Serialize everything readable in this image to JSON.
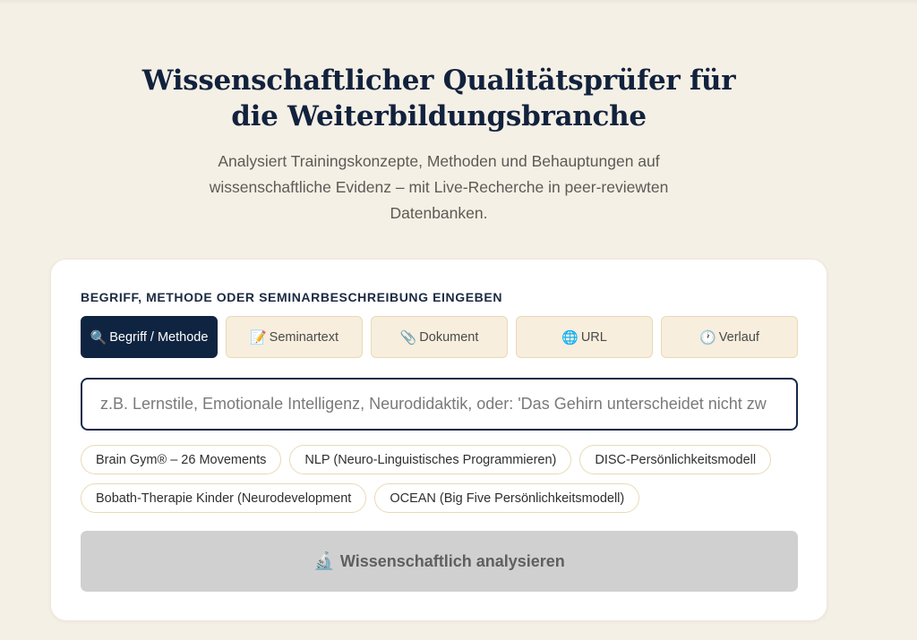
{
  "header": {
    "title": "Wissenschaftlicher Qualitätsprüfer für die Weiterbildungsbranche",
    "subtitle": "Analysiert Trainingskonzepte, Methoden und Behauptungen auf wissenschaftliche Evidenz – mit Live-Recherche in peer-reviewten Datenbanken."
  },
  "form": {
    "section_label": "BEGRIFF, METHODE ODER SEMINARBESCHREIBUNG EINGEBEN",
    "tabs": [
      {
        "icon": "🔍",
        "icon_name": "magnifier-icon",
        "label": "Begriff / Methode",
        "active": true
      },
      {
        "icon": "📝",
        "icon_name": "memo-icon",
        "label": "Seminartext",
        "active": false
      },
      {
        "icon": "📎",
        "icon_name": "paperclip-icon",
        "label": "Dokument",
        "active": false
      },
      {
        "icon": "🌐",
        "icon_name": "globe-icon",
        "label": "URL",
        "active": false
      },
      {
        "icon": "🕐",
        "icon_name": "clock-icon",
        "label": "Verlauf",
        "active": false
      }
    ],
    "input": {
      "value": "",
      "placeholder": "z.B. Lernstile, Emotionale Intelligenz, Neurodidaktik, oder: 'Das Gehirn unterscheidet nicht zw"
    },
    "suggestions": [
      "Brain Gym® – 26 Movements",
      "NLP (Neuro-Linguistisches Programmieren)",
      "DISC-Persönlichkeitsmodell",
      "Bobath-Therapie Kinder (Neurodevelopment",
      "OCEAN (Big Five Persönlichkeitsmodell)"
    ],
    "submit": {
      "icon": "🔬",
      "icon_name": "microscope-icon",
      "label": "Wissenschaftlich analysieren"
    }
  },
  "colors": {
    "background": "#f5f0e6",
    "accent": "#0f2440",
    "tab_background": "#f7eedd",
    "button_disabled": "#d0d0d0"
  }
}
